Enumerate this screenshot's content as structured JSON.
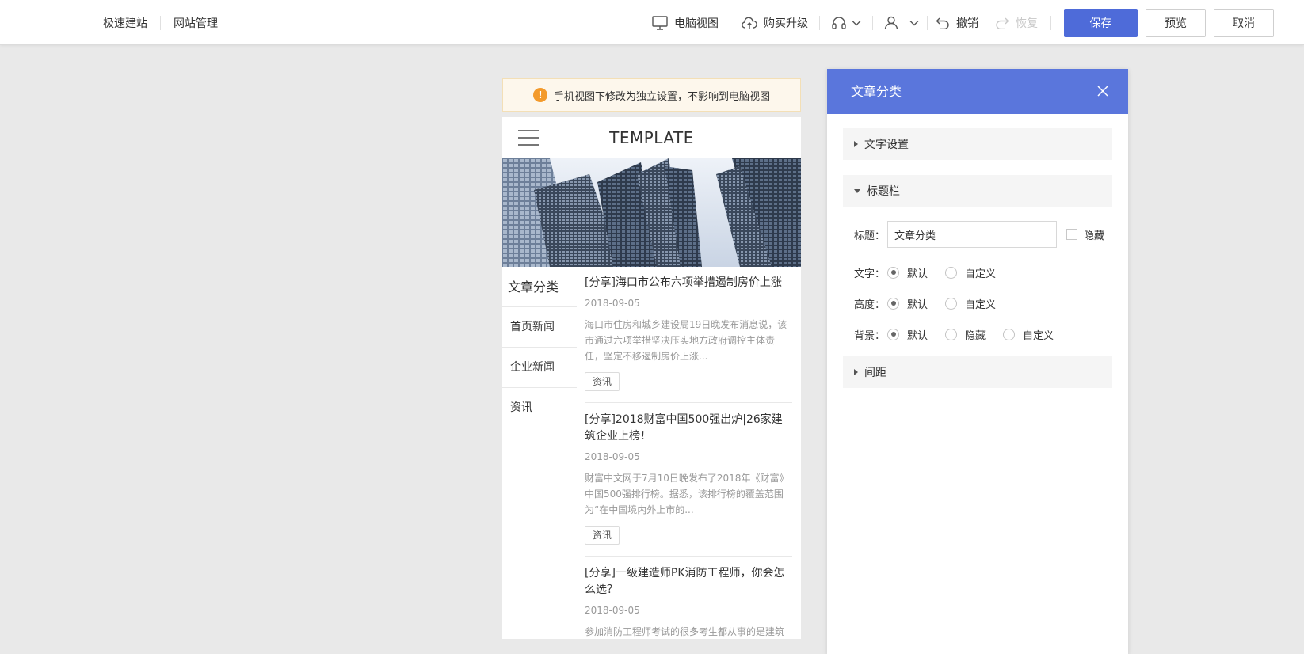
{
  "topbar": {
    "nav": [
      "极速建站",
      "网站管理"
    ],
    "tools": {
      "pc_view": "电脑视图",
      "upgrade": "购买升级",
      "undo": "撤销",
      "redo": "恢复"
    },
    "buttons": {
      "save": "保存",
      "preview": "预览",
      "cancel": "取消"
    },
    "colors": {
      "primary": "#4e6bd9"
    }
  },
  "preview": {
    "notice": "手机视图下修改为独立设置，不影响到电脑视图",
    "phone_title": "TEMPLATE",
    "categories": [
      "文章分类",
      "首页新闻",
      "企业新闻",
      "资讯"
    ],
    "articles": [
      {
        "title": "[分享]海口市公布六项举措遏制房价上涨",
        "date": "2018-09-05",
        "summary": "海口市住房和城乡建设局19日晚发布消息说，该市通过六项举措坚决压实地方政府调控主体责任，坚定不移遏制房价上涨...",
        "tag": "资讯"
      },
      {
        "title": "[分享]2018财富中国500强出炉|26家建筑企业上榜！",
        "date": "2018-09-05",
        "summary": "财富中文网于7月10日晚发布了2018年《财富》中国500强排行榜。据悉，该排行榜的覆盖范围为“在中国境内外上市的...",
        "tag": "资讯"
      },
      {
        "title": "[分享]一级建造师PK消防工程师，你会怎么选？",
        "date": "2018-09-05",
        "summary": "参加消防工程师考试的很多考生都从事的是建筑",
        "tag": ""
      }
    ]
  },
  "panel": {
    "title": "文章分类",
    "sections": {
      "text_settings": "文字设置",
      "title_bar": "标题栏",
      "spacing": "间距"
    },
    "form": {
      "title_label": "标题：",
      "title_value": "文章分类",
      "hide_label": "隐藏",
      "text_label": "文字：",
      "height_label": "高度：",
      "bg_label": "背景：",
      "opt_default": "默认",
      "opt_custom": "自定义",
      "opt_hide": "隐藏"
    },
    "colors": {
      "header": "#5a76dc"
    }
  }
}
